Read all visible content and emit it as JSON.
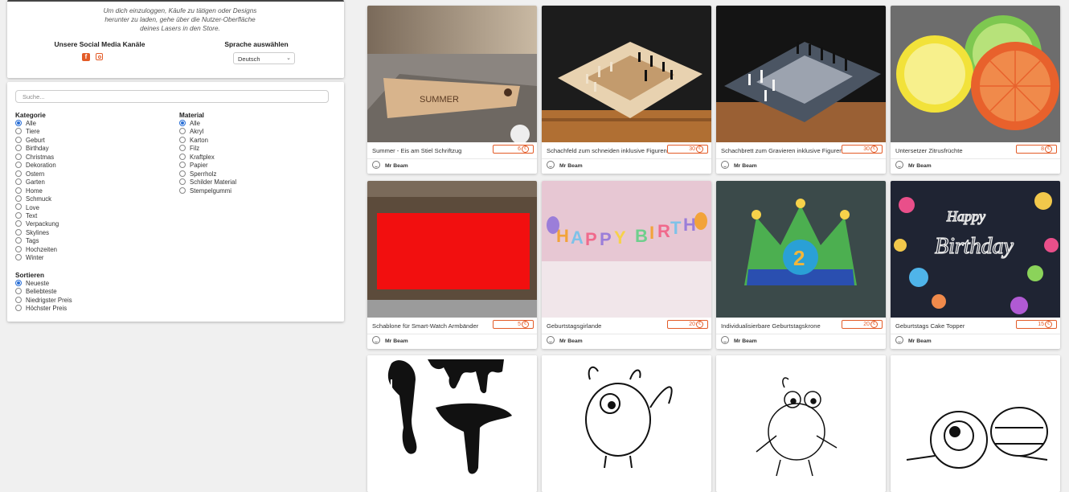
{
  "info": {
    "login_text": "Um dich einzuloggen, Käufe zu tätigen oder Designs herunter zu laden, gehe über die Nutzer-Oberfläche deines Lasers in den Store.",
    "social_title": "Unsere Social Media Kanäle",
    "social_icons": [
      "facebook-icon",
      "instagram-icon"
    ],
    "language_title": "Sprache auswählen",
    "language_selected": "Deutsch"
  },
  "filters": {
    "search_placeholder": "Suche...",
    "category_title": "Kategorie",
    "categories": [
      "Alle",
      "Tiere",
      "Geburt",
      "Birthday",
      "Christmas",
      "Dekoration",
      "Ostern",
      "Garten",
      "Home",
      "Schmuck",
      "Love",
      "Text",
      "Verpackung",
      "Skylines",
      "Tags",
      "Hochzeiten",
      "Winter"
    ],
    "category_selected": "Alle",
    "material_title": "Material",
    "materials": [
      "Alle",
      "Akryl",
      "Karton",
      "Filz",
      "Kraftplex",
      "Papier",
      "Sperrholz",
      "Schilder Material",
      "Stempelgummi"
    ],
    "material_selected": "Alle",
    "sort_title": "Sortieren",
    "sort_options": [
      "Neueste",
      "Beliebteste",
      "Niedrigster Preis",
      "Höchster Preis"
    ],
    "sort_selected": "Neueste"
  },
  "colors": {
    "accent": "#e35b27",
    "radio_active": "#2a6fd6"
  },
  "products": [
    {
      "name": "Summer - Eis am Stiel Schriftzug",
      "price": "6",
      "author": "Mr Beam"
    },
    {
      "name": "Schachfeld zum schneiden inklusive Figuren",
      "price": "30",
      "author": "Mr Beam"
    },
    {
      "name": "Schachbrett zum Gravieren inklusive Figuren",
      "price": "30",
      "author": "Mr Beam"
    },
    {
      "name": "Untersetzer Zitrusfrüchte",
      "price": "8",
      "author": "Mr Beam"
    },
    {
      "name": "Schablone für Smart-Watch Armbänder",
      "price": "5",
      "author": "Mr Beam"
    },
    {
      "name": "Geburtstagsgirlande",
      "price": "20",
      "author": "Mr Beam"
    },
    {
      "name": "Individualisierbare Geburtstagskrone",
      "price": "20",
      "author": "Mr Beam"
    },
    {
      "name": "Geburtstags Cake Topper",
      "price": "15",
      "author": "Mr Beam"
    }
  ],
  "currency_symbol": "€"
}
